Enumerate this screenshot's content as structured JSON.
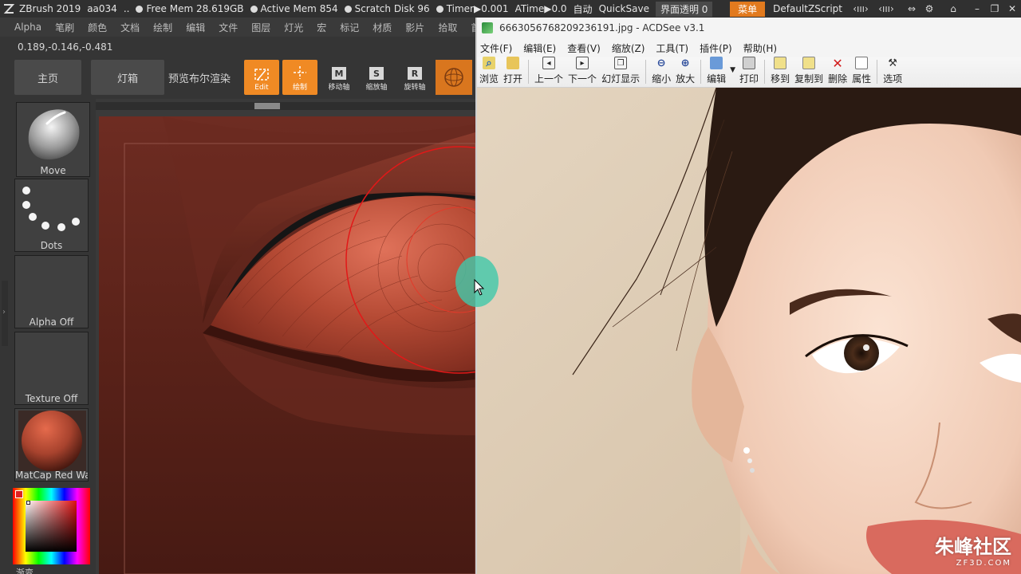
{
  "zbrush": {
    "app_name": "ZBrush 2019",
    "doc_name": "aa034",
    "ellipsis": "..",
    "free_mem": "Free Mem 28.619GB",
    "active_mem": "Active Mem 854",
    "scratch_disk": "Scratch Disk 96",
    "timer": "Timer▶0.001",
    "atime": "ATime▶0.0",
    "auto": "自动",
    "quicksave": "QuickSave",
    "ui_transparency": "界面透明 0",
    "menu_button": "菜单",
    "default_script": "DefaultZScript",
    "menus": [
      "Alpha",
      "笔刷",
      "颜色",
      "文档",
      "绘制",
      "编辑",
      "文件",
      "图层",
      "灯光",
      "宏",
      "标记",
      "材质",
      "影片",
      "拾取",
      "首选"
    ],
    "coords": "0.189,-0.146,-0.481",
    "toolbar": {
      "home": "主页",
      "lightbox": "灯箱",
      "bpr": "预览布尔渲染",
      "edit": "Edit",
      "draw": "绘制",
      "move": "移动轴",
      "scale": "缩放轴",
      "rotate": "旋转轴",
      "move_key": "M",
      "scale_key": "S",
      "rotate_key": "R"
    },
    "tray": {
      "brush": "Move",
      "stroke": "Dots",
      "alpha": "Alpha Off",
      "texture": "Texture Off",
      "material": "MatCap Red Wax",
      "gradient": "渐变"
    }
  },
  "acdsee": {
    "title": "6663056768209236191.jpg - ACDSee v3.1",
    "menus": [
      "文件(F)",
      "编辑(E)",
      "查看(V)",
      "缩放(Z)",
      "工具(T)",
      "插件(P)",
      "帮助(H)"
    ],
    "toolbar": {
      "browse": "浏览",
      "open": "打开",
      "prev": "上一个",
      "next": "下一个",
      "slideshow": "幻灯显示",
      "zoom_out": "缩小",
      "zoom_in": "放大",
      "edit": "编辑",
      "print": "打印",
      "move_to": "移到",
      "copy_to": "复制到",
      "delete": "删除",
      "properties": "属性",
      "options": "选项"
    }
  },
  "watermark": {
    "main": "朱峰社区",
    "sub": "ZF3D.COM"
  },
  "colors": {
    "accent_orange": "#f08a24",
    "zbrush_bg": "#353535",
    "lip_red": "#a8432e"
  }
}
